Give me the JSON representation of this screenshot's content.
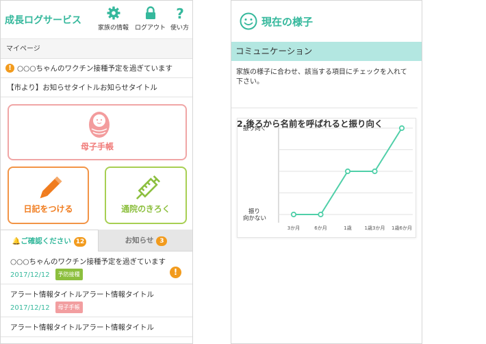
{
  "left": {
    "app_title": "成長ログサービス",
    "header_buttons": [
      {
        "label": "家族の情報",
        "icon": "gear-icon"
      },
      {
        "label": "ログアウト",
        "icon": "lock-icon"
      },
      {
        "label": "使い方",
        "icon": "question-icon"
      }
    ],
    "mypage_label": "マイページ",
    "alert_text": "○○○ちゃんのワクチン接種予定を過ぎています",
    "notice_text": "【市より】お知らせタイトルお知らせタイトル",
    "tiles": {
      "boshi": "母子手帳",
      "diary": "日記をつける",
      "clinic": "通院のきろく"
    },
    "tabs": {
      "confirm_label": "ご確認ください",
      "confirm_count": "12",
      "news_label": "お知らせ",
      "news_count": "3"
    },
    "list_items": [
      {
        "text": "○○○ちゃんのワクチン接種予定を過ぎています",
        "date": "2017/12/12",
        "badge": "予防接種",
        "badge_color": "#8cbf3e"
      },
      {
        "text": "アラート情報タイトルアラート情報タイトル",
        "date": "2017/12/12",
        "badge": "母子手帳",
        "badge_color": "#f29ea0"
      },
      {
        "text": "アラート情報タイトルアラート情報タイトル"
      }
    ]
  },
  "right": {
    "title": "現在の様子",
    "section": "コミュニケーション",
    "instruction": "家族の様子に合わせ、該当する項目にチェックを入れて下さい。",
    "question": "2.後ろから名前を呼ばれると振り向く"
  },
  "colors": {
    "accent": "#35b89c",
    "warning": "#f29b1d",
    "section_bg": "#b3e7e1"
  },
  "chart_data": {
    "type": "line",
    "categories": [
      "3か月",
      "6か月",
      "1歳",
      "1歳3か月",
      "1歳6か月"
    ],
    "values": [
      0,
      0,
      0.5,
      0.5,
      1
    ],
    "y_top_label": "振り向く",
    "y_bottom_label": [
      "振り",
      "向かない"
    ],
    "ylim": [
      0,
      1
    ],
    "grid": true,
    "color": "#4fcfa8"
  }
}
